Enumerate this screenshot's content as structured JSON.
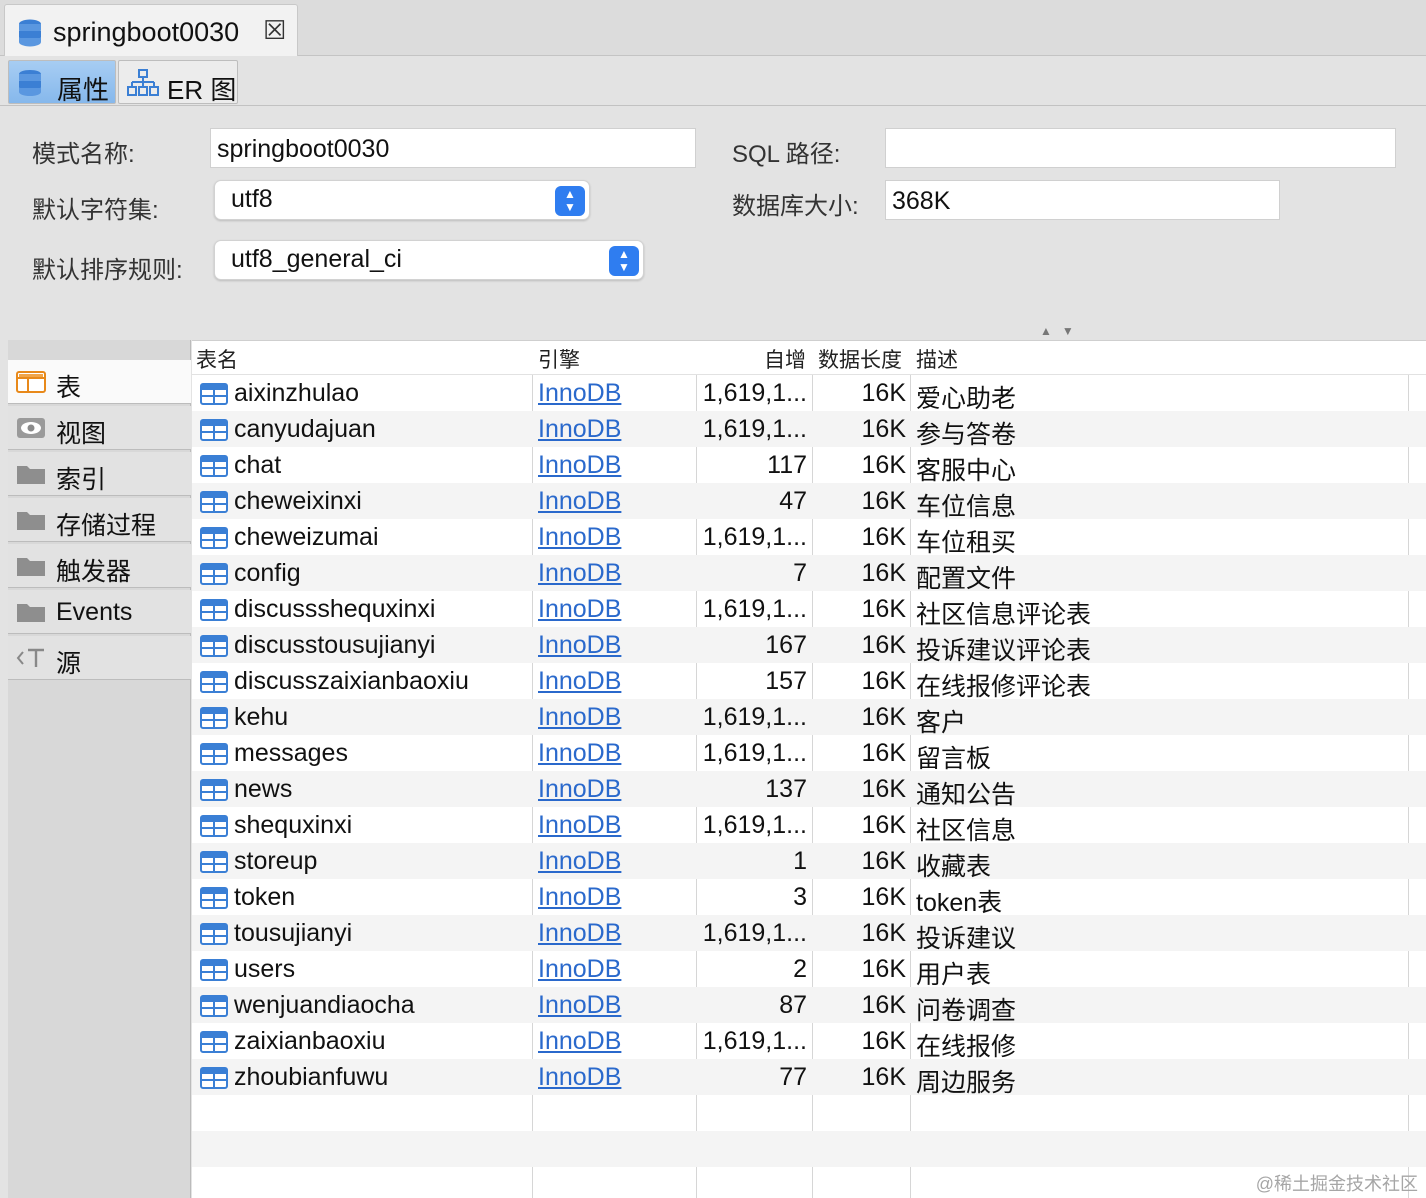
{
  "tab": {
    "title": "springboot0030",
    "close_icon": "close-icon"
  },
  "subtabs": [
    {
      "label": "属性",
      "icon": "database-icon",
      "active": true
    },
    {
      "label": "ER 图",
      "icon": "er-diagram-icon",
      "active": false
    }
  ],
  "properties": {
    "schema_name_label": "模式名称:",
    "schema_name_value": "springboot0030",
    "charset_label": "默认字符集:",
    "charset_value": "utf8",
    "collation_label": "默认排序规则:",
    "collation_value": "utf8_general_ci",
    "sql_path_label": "SQL 路径:",
    "sql_path_value": "",
    "db_size_label": "数据库大小:",
    "db_size_value": "368K"
  },
  "nav": [
    {
      "label": "表",
      "icon": "table-icon",
      "active": true
    },
    {
      "label": "视图",
      "icon": "eye-icon",
      "active": false
    },
    {
      "label": "索引",
      "icon": "folder-icon",
      "active": false
    },
    {
      "label": "存储过程",
      "icon": "folder-icon",
      "active": false
    },
    {
      "label": "触发器",
      "icon": "folder-icon",
      "active": false
    },
    {
      "label": "Events",
      "icon": "folder-icon",
      "active": false
    },
    {
      "label": "源",
      "icon": "source-icon",
      "active": false
    }
  ],
  "table": {
    "headers": {
      "name": "表名",
      "engine": "引擎",
      "auto_inc": "自增",
      "data_len": "数据长度",
      "desc": "描述"
    },
    "rows": [
      {
        "name": "aixinzhulao",
        "engine": "InnoDB",
        "auto_inc": "1,619,1...",
        "data_len": "16K",
        "desc": "爱心助老"
      },
      {
        "name": "canyudajuan",
        "engine": "InnoDB",
        "auto_inc": "1,619,1...",
        "data_len": "16K",
        "desc": "参与答卷"
      },
      {
        "name": "chat",
        "engine": "InnoDB",
        "auto_inc": "117",
        "data_len": "16K",
        "desc": "客服中心"
      },
      {
        "name": "cheweixinxi",
        "engine": "InnoDB",
        "auto_inc": "47",
        "data_len": "16K",
        "desc": "车位信息"
      },
      {
        "name": "cheweizumai",
        "engine": "InnoDB",
        "auto_inc": "1,619,1...",
        "data_len": "16K",
        "desc": "车位租买"
      },
      {
        "name": "config",
        "engine": "InnoDB",
        "auto_inc": "7",
        "data_len": "16K",
        "desc": "配置文件"
      },
      {
        "name": "discussshequxinxi",
        "engine": "InnoDB",
        "auto_inc": "1,619,1...",
        "data_len": "16K",
        "desc": "社区信息评论表"
      },
      {
        "name": "discusstousujianyi",
        "engine": "InnoDB",
        "auto_inc": "167",
        "data_len": "16K",
        "desc": "投诉建议评论表"
      },
      {
        "name": "discusszaixianbaoxiu",
        "engine": "InnoDB",
        "auto_inc": "157",
        "data_len": "16K",
        "desc": "在线报修评论表"
      },
      {
        "name": "kehu",
        "engine": "InnoDB",
        "auto_inc": "1,619,1...",
        "data_len": "16K",
        "desc": "客户"
      },
      {
        "name": "messages",
        "engine": "InnoDB",
        "auto_inc": "1,619,1...",
        "data_len": "16K",
        "desc": "留言板"
      },
      {
        "name": "news",
        "engine": "InnoDB",
        "auto_inc": "137",
        "data_len": "16K",
        "desc": "通知公告"
      },
      {
        "name": "shequxinxi",
        "engine": "InnoDB",
        "auto_inc": "1,619,1...",
        "data_len": "16K",
        "desc": "社区信息"
      },
      {
        "name": "storeup",
        "engine": "InnoDB",
        "auto_inc": "1",
        "data_len": "16K",
        "desc": "收藏表"
      },
      {
        "name": "token",
        "engine": "InnoDB",
        "auto_inc": "3",
        "data_len": "16K",
        "desc": "token表"
      },
      {
        "name": "tousujianyi",
        "engine": "InnoDB",
        "auto_inc": "1,619,1...",
        "data_len": "16K",
        "desc": "投诉建议"
      },
      {
        "name": "users",
        "engine": "InnoDB",
        "auto_inc": "2",
        "data_len": "16K",
        "desc": "用户表"
      },
      {
        "name": "wenjuandiaocha",
        "engine": "InnoDB",
        "auto_inc": "87",
        "data_len": "16K",
        "desc": "问卷调查"
      },
      {
        "name": "zaixianbaoxiu",
        "engine": "InnoDB",
        "auto_inc": "1,619,1...",
        "data_len": "16K",
        "desc": "在线报修"
      },
      {
        "name": "zhoubianfuwu",
        "engine": "InnoDB",
        "auto_inc": "77",
        "data_len": "16K",
        "desc": "周边服务"
      }
    ]
  },
  "watermark": "@稀土掘金技术社区",
  "colors": {
    "accent": "#2f7df0",
    "link": "#2a69cc",
    "tab_active": "#9fc8f2"
  }
}
